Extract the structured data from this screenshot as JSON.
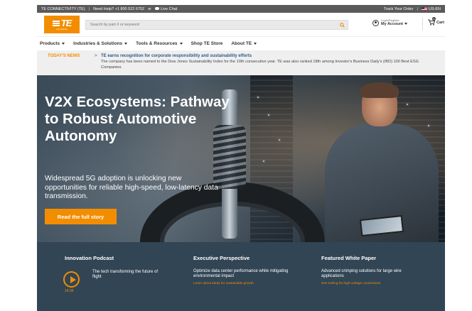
{
  "util_bar": {
    "brand": "TE CONNECTIVITY (TE)",
    "help": "Need Help? +1 800 522 6752",
    "or": "or",
    "live_chat": "Live Chat",
    "track_order": "Track Your Order",
    "locale": "US-EN"
  },
  "header": {
    "logo_text": "TE",
    "logo_sub": "connectivity",
    "search_placeholder": "Search by part # or keyword",
    "account_small": "Login/Register",
    "account_main": "My Account",
    "cart_label": "Cart",
    "cart_count": "0"
  },
  "nav": {
    "items": [
      {
        "label": "Products",
        "dropdown": true
      },
      {
        "label": "Industries & Solutions",
        "dropdown": true
      },
      {
        "label": "Tools & Resources",
        "dropdown": true
      },
      {
        "label": "Shop TE Store",
        "dropdown": false
      },
      {
        "label": "About TE",
        "dropdown": true
      }
    ]
  },
  "news": {
    "label": "TODAY'S NEWS",
    "arrow": ">",
    "headline": "TE earns recognition for corporate responsibility and sustainability efforts",
    "body": "The company has been named to the Dow Jones Sustainability Index for the 10th consecutive year. TE was also ranked 18th among Investor's Business Daily's (IBD) 100 Best ESG Companies."
  },
  "hero": {
    "title": "V2X Ecosystems: Pathway to Robust Automotive Autonomy",
    "text": "Widespread 5G adoption is unlocking new opportunities for reliable high-speed, low-latency data transmission.",
    "button": "Read the full story"
  },
  "features": {
    "podcast": {
      "title": "Innovation Podcast",
      "desc": "The tech transforming the future of flight",
      "duration": "14:36"
    },
    "executive": {
      "title": "Executive Perspective",
      "desc": "Optimize data center performance while mitigating environmental impact",
      "link": "Learn about ideas for sustainable growth"
    },
    "whitepaper": {
      "title": "Featured White Paper",
      "desc": "Advanced crimping solutions for large wire applications",
      "link": "See tooling for high-voltage connections"
    }
  },
  "colors": {
    "brand_orange": "#f28d00",
    "news_blue": "#2a5b87",
    "feature_bg": "#324555"
  }
}
